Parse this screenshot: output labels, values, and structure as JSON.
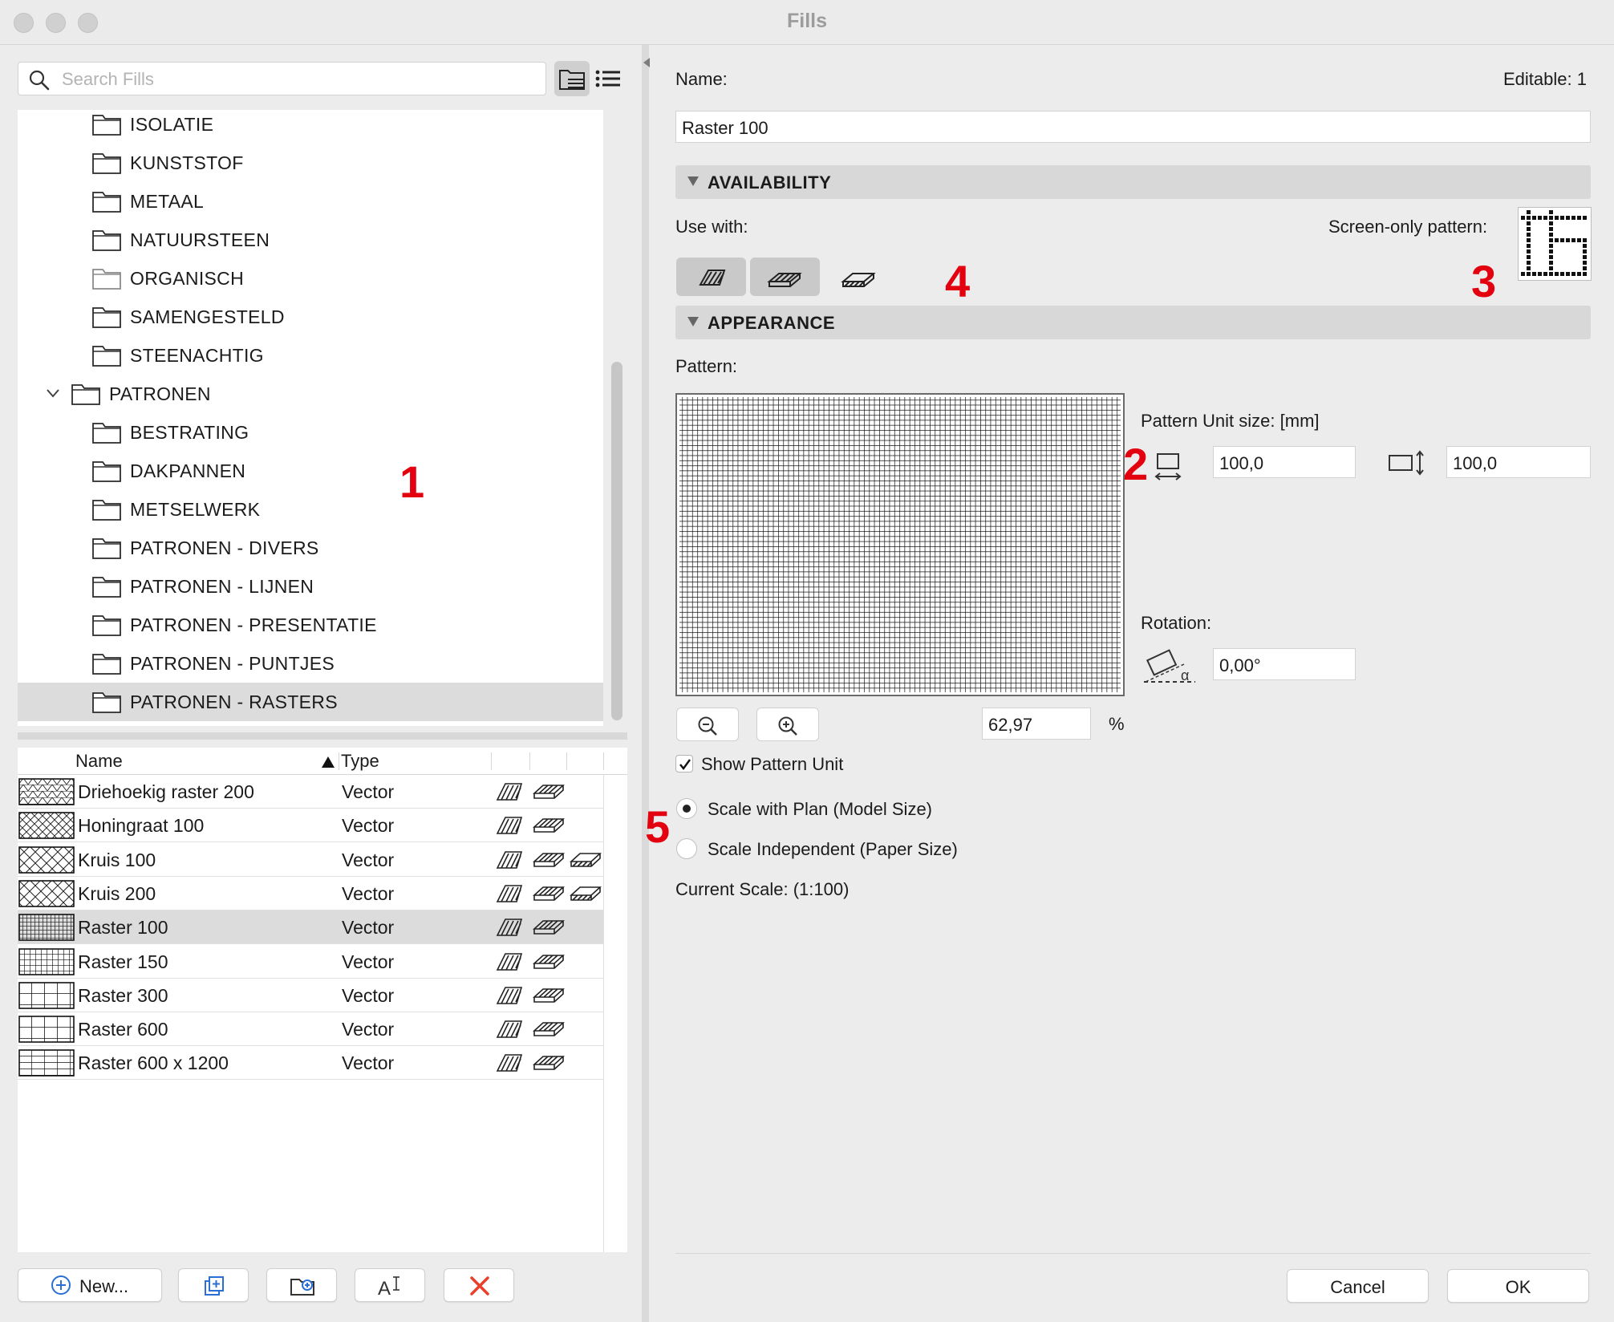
{
  "window": {
    "title": "Fills"
  },
  "search": {
    "placeholder": "Search Fills"
  },
  "tree": {
    "items": [
      {
        "label": "ISOLATIE",
        "level": 2
      },
      {
        "label": "KUNSTSTOF",
        "level": 2
      },
      {
        "label": "METAAL",
        "level": 2
      },
      {
        "label": "NATUURSTEEN",
        "level": 2
      },
      {
        "label": "ORGANISCH",
        "level": 2
      },
      {
        "label": "SAMENGESTELD",
        "level": 2
      },
      {
        "label": "STEENACHTIG",
        "level": 2
      },
      {
        "label": "PATRONEN",
        "level": 1,
        "expanded": true
      },
      {
        "label": "BESTRATING",
        "level": 2
      },
      {
        "label": "DAKPANNEN",
        "level": 2
      },
      {
        "label": "METSELWERK",
        "level": 2
      },
      {
        "label": "PATRONEN - DIVERS",
        "level": 2
      },
      {
        "label": "PATRONEN - LIJNEN",
        "level": 2
      },
      {
        "label": "PATRONEN - PRESENTATIE",
        "level": 2
      },
      {
        "label": "PATRONEN - PUNTJES",
        "level": 2
      },
      {
        "label": "PATRONEN - RASTERS",
        "level": 2,
        "selected": true
      }
    ]
  },
  "table": {
    "headers": {
      "name": "Name",
      "type": "Type"
    },
    "rows": [
      {
        "name": "Driehoekig raster 200",
        "type": "Vector",
        "uses": [
          "cut",
          "cover"
        ],
        "pattern": "triangle"
      },
      {
        "name": "Honingraat 100",
        "type": "Vector",
        "uses": [
          "cut",
          "cover"
        ],
        "pattern": "honeycomb"
      },
      {
        "name": "Kruis 100",
        "type": "Vector",
        "uses": [
          "cut",
          "cover",
          "surface"
        ],
        "pattern": "cross"
      },
      {
        "name": "Kruis 200",
        "type": "Vector",
        "uses": [
          "cut",
          "cover",
          "surface"
        ],
        "pattern": "cross"
      },
      {
        "name": "Raster 100",
        "type": "Vector",
        "uses": [
          "cut",
          "cover"
        ],
        "pattern": "grid-fine",
        "selected": true
      },
      {
        "name": "Raster 150",
        "type": "Vector",
        "uses": [
          "cut",
          "cover"
        ],
        "pattern": "grid-medium"
      },
      {
        "name": "Raster 300",
        "type": "Vector",
        "uses": [
          "cut",
          "cover"
        ],
        "pattern": "grid-coarse"
      },
      {
        "name": "Raster 600",
        "type": "Vector",
        "uses": [
          "cut",
          "cover"
        ],
        "pattern": "grid-coarse"
      },
      {
        "name": "Raster 600 x 1200",
        "type": "Vector",
        "uses": [
          "cut",
          "cover"
        ],
        "pattern": "grid-rect"
      }
    ]
  },
  "bottom_buttons": {
    "new_label": "New..."
  },
  "details": {
    "name_label": "Name:",
    "editable_label": "Editable: 1",
    "name_value": "Raster 100",
    "availability_title": "AVAILABILITY",
    "use_with_label": "Use with:",
    "screen_only_label": "Screen-only pattern:",
    "appearance_title": "APPEARANCE",
    "pattern_label": "Pattern:",
    "unit_size_label": "Pattern Unit size: [mm]",
    "unit_width": "100,0",
    "unit_height": "100,0",
    "rotation_label": "Rotation:",
    "rotation_value": "0,00°",
    "zoom_value": "62,97",
    "zoom_unit": "%",
    "show_unit_label": "Show Pattern Unit",
    "show_unit_checked": true,
    "scale_plan_label": "Scale with Plan (Model Size)",
    "scale_paper_label": "Scale Independent (Paper Size)",
    "scale_mode": "plan",
    "current_scale": "Current Scale: (1:100)"
  },
  "annotations": {
    "n1": "1",
    "n2": "2",
    "n3": "3",
    "n4": "4",
    "n5": "5"
  },
  "footer": {
    "cancel_label": "Cancel",
    "ok_label": "OK"
  },
  "colors": {
    "annotation_red": "#e3000f",
    "delete_red": "#e8402a",
    "selection_gray": "#dcdcdc"
  }
}
